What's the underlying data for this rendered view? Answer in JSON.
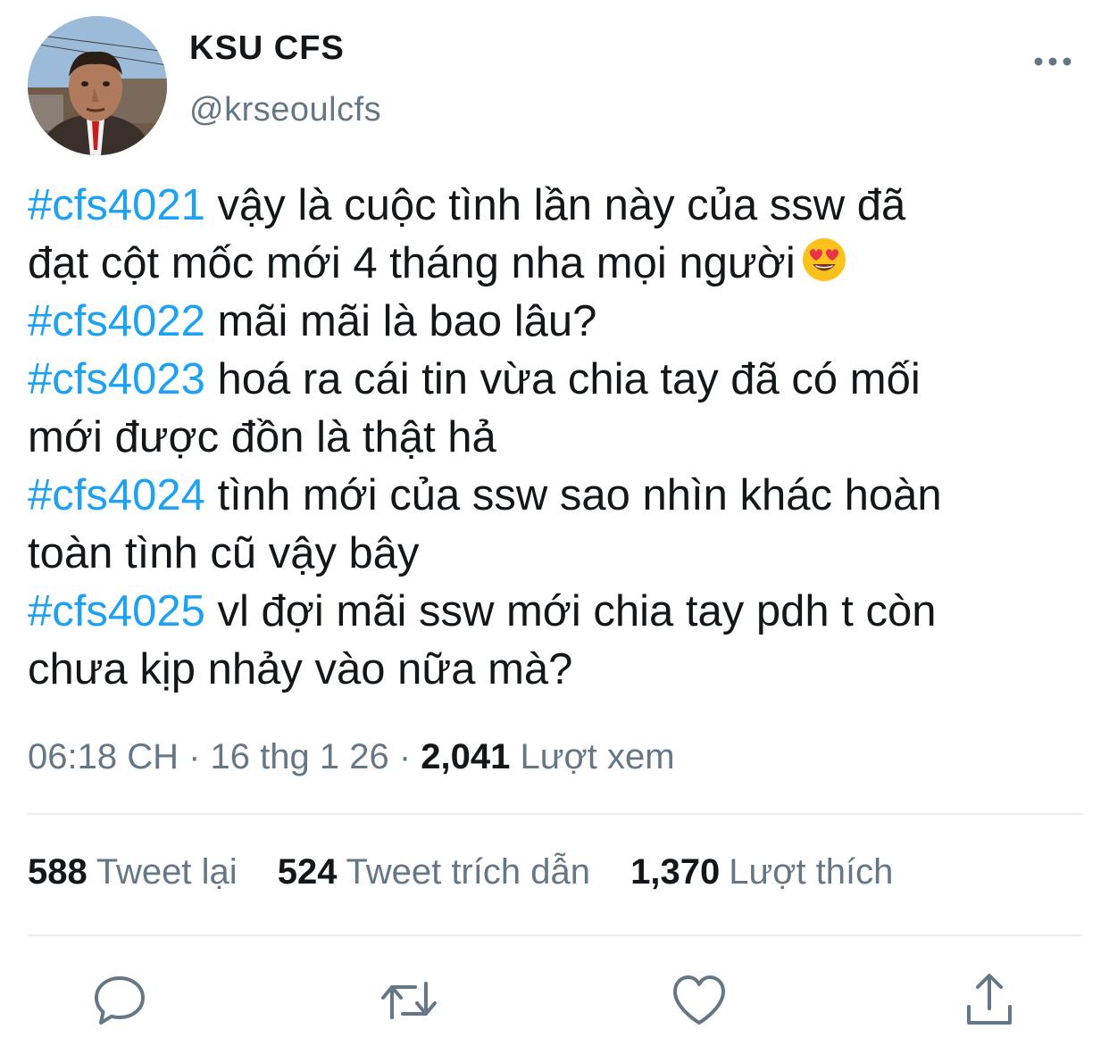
{
  "user": {
    "display_name": "KSU CFS",
    "handle": "@krseoulcfs"
  },
  "tweet": {
    "lines": [
      {
        "tag": "#cfs4021",
        "text": " vậy là cuộc tình lần này của ssw đã"
      },
      {
        "tag": "",
        "text": "đạt cột mốc mới 4 tháng nha mọi người",
        "emoji": "heart-eyes-emoji"
      },
      {
        "tag": "#cfs4022",
        "text": " mãi mãi là bao lâu?"
      },
      {
        "tag": "#cfs4023",
        "text": " hoá ra cái tin vừa chia tay đã có mối"
      },
      {
        "tag": "",
        "text": "mới được đồn là thật hả"
      },
      {
        "tag": "#cfs4024",
        "text": " tình mới của ssw sao nhìn khác hoàn"
      },
      {
        "tag": "",
        "text": "toàn tình cũ vậy bây"
      },
      {
        "tag": "#cfs4025",
        "text": " vl đợi mãi ssw mới chia tay pdh t còn"
      },
      {
        "tag": "",
        "text": "chưa kịp nhảy vào nữa mà?"
      }
    ]
  },
  "meta": {
    "time": "06:18 CH",
    "separator1": " · ",
    "date": "16 thg 1 26",
    "separator2": " · ",
    "views_count": "2,041",
    "views_label": " Lượt xem"
  },
  "stats": {
    "retweets_count": "588",
    "retweets_label": "Tweet lại",
    "quotes_count": "524",
    "quotes_label": "Tweet trích dẫn",
    "likes_count": "1,370",
    "likes_label": "Lượt thích"
  },
  "colors": {
    "hashtag": "#1da1f2",
    "secondary_text": "#657786",
    "icon": "#657786",
    "divider": "#e6ecf0"
  },
  "icons": {
    "more": "more-dots-icon",
    "reply": "reply-bubble-icon",
    "retweet": "retweet-arrows-icon",
    "like": "heart-icon",
    "share": "share-upload-icon"
  }
}
